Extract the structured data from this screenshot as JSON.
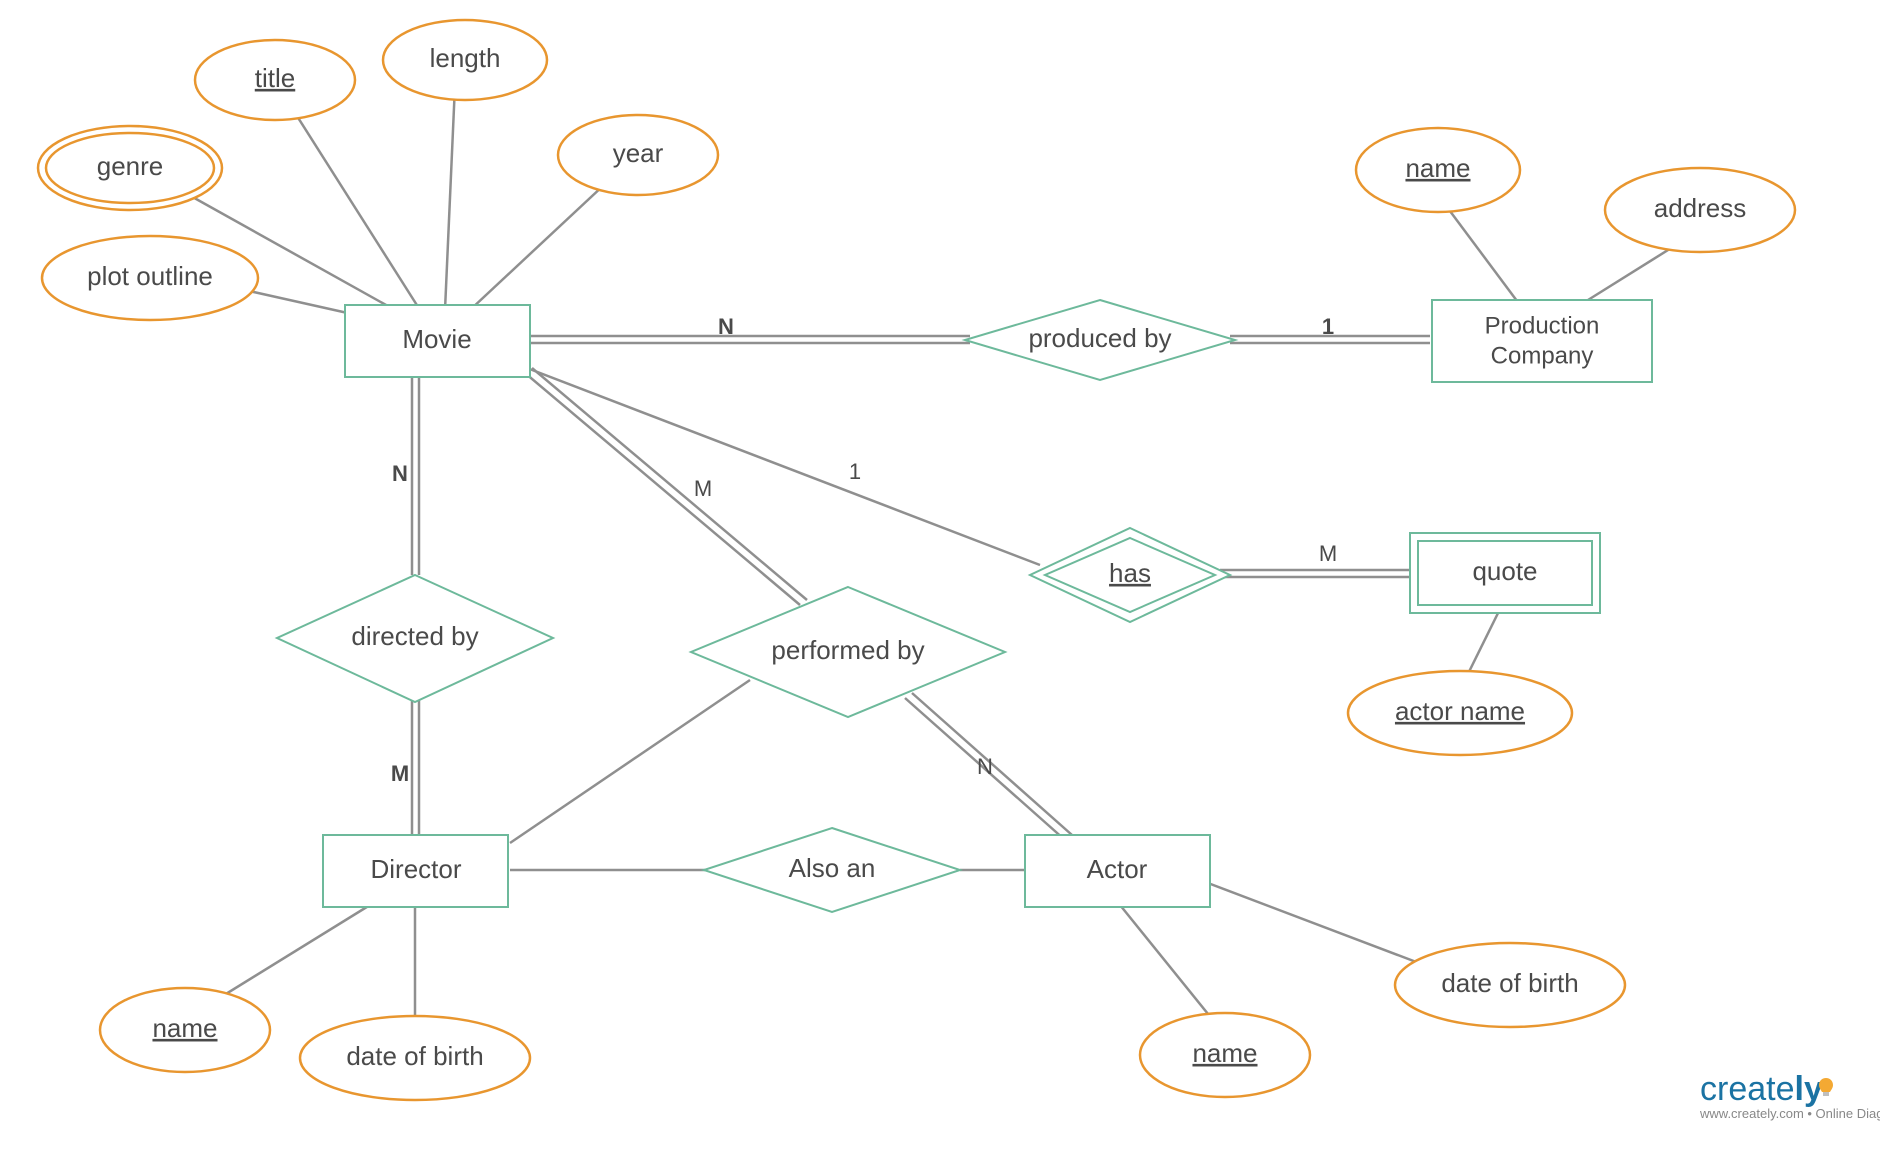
{
  "entities": {
    "movie": "Movie",
    "production_company_l1": "Production",
    "production_company_l2": "Company",
    "director": "Director",
    "actor": "Actor",
    "quote": "quote"
  },
  "attributes": {
    "genre": "genre",
    "title": "title",
    "length": "length",
    "year": "year",
    "plot_outline": "plot outline",
    "pc_name": "name",
    "pc_address": "address",
    "director_name": "name",
    "director_dob": "date of birth",
    "actor_name": "name",
    "actor_dob": "date of birth",
    "quote_actor_name": "actor name"
  },
  "relationships": {
    "produced_by": "produced by",
    "directed_by": "directed by",
    "performed_by": "performed by",
    "has": "has",
    "also_an": "Also an"
  },
  "cardinalities": {
    "movie_produced_N": "N",
    "pc_produced_1": "1",
    "movie_directed_N": "N",
    "director_directed_M": "M",
    "movie_performed_M": "M",
    "actor_performed_N": "N",
    "movie_has_1": "1",
    "quote_has_M": "M"
  },
  "watermark": {
    "brand_part1": "create",
    "brand_part2": "ly",
    "tagline": "www.creately.com • Online Diagramming"
  }
}
